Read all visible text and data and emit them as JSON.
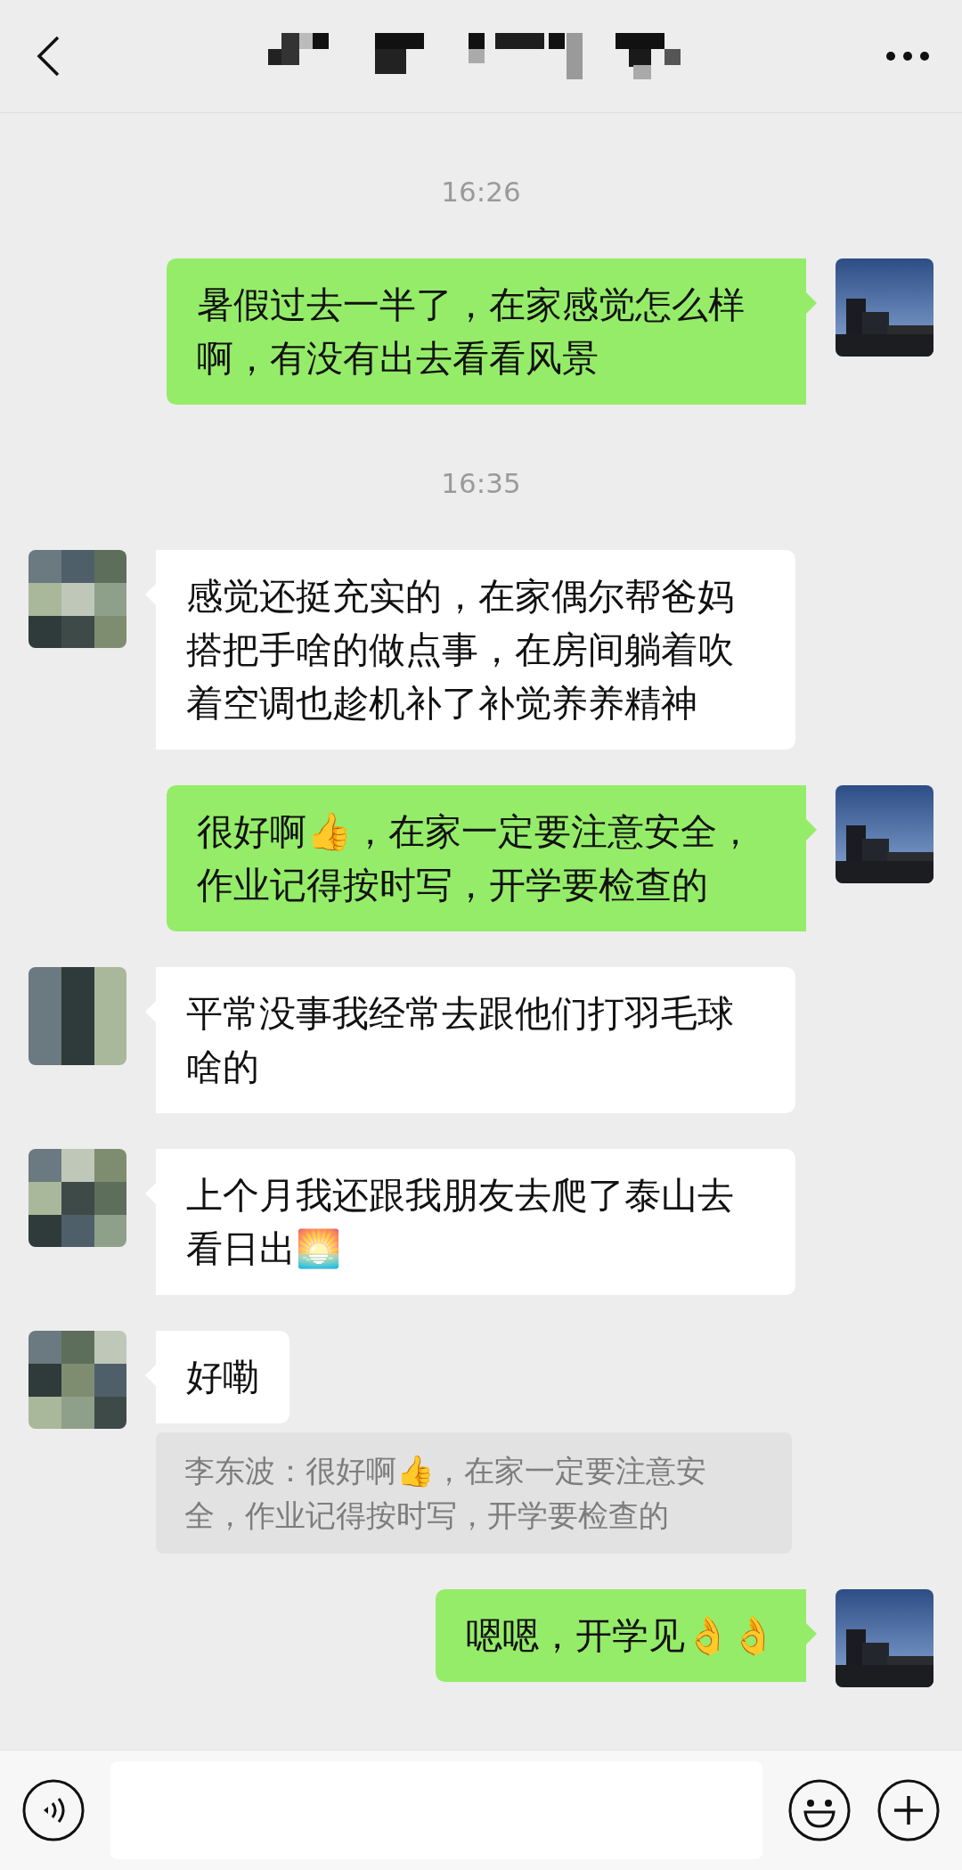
{
  "messages": [
    {
      "kind": "time",
      "text": "16:26"
    },
    {
      "kind": "message",
      "outgoing": true,
      "text": "暑假过去一半了，在家感觉怎么样啊，有没有出去看看风景"
    },
    {
      "kind": "time",
      "text": "16:35"
    },
    {
      "kind": "message",
      "outgoing": false,
      "text": "感觉还挺充实的，在家偶尔帮爸妈搭把手啥的做点事，在房间躺着吹着空调也趁机补了补觉养养精神"
    },
    {
      "kind": "message",
      "outgoing": true,
      "text": "很好啊👍，在家一定要注意安全，作业记得按时写，开学要检查的"
    },
    {
      "kind": "message",
      "outgoing": false,
      "text": "平常没事我经常去跟他们打羽毛球啥的"
    },
    {
      "kind": "message",
      "outgoing": false,
      "text": "上个月我还跟我朋友去爬了泰山去看日出🌅"
    },
    {
      "kind": "message",
      "outgoing": false,
      "text": "好嘞",
      "quote": "李东波：很好啊👍，在家一定要注意安全，作业记得按时写，开学要检查的"
    },
    {
      "kind": "message",
      "outgoing": true,
      "text": "嗯嗯，开学见👌👌"
    }
  ]
}
